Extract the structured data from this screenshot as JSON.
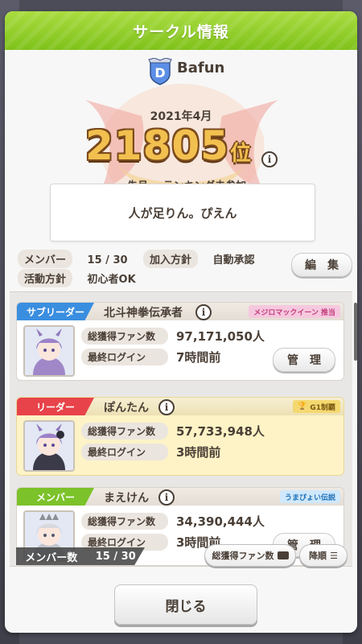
{
  "dialog": {
    "title": "サークル情報"
  },
  "club": {
    "name": "Bafun",
    "month": "2021年4月",
    "rank_number": "21805",
    "rank_suffix": "位",
    "prev_label": "先月",
    "prev_value": "ランキング未参加",
    "comment": "人が足りん。ぴえん",
    "members_label": "メンバー",
    "members_value": "15 / 30",
    "join_label": "加入方針",
    "join_value": "自動承認",
    "policy_label": "活動方針",
    "policy_value": "初心者OK",
    "edit_button": "編　集"
  },
  "members": [
    {
      "role": "サブリーダー",
      "role_color": "#3a8ee0",
      "name": "北斗神拳伝承者",
      "badge": "メジロマックイーン 推当",
      "badge_bg": "#f6c8de",
      "badge_color": "#c23d7e",
      "fans_label": "総獲得ファン数",
      "fans": "97,171,050人",
      "login_label": "最終ログイン",
      "login": "7時間前",
      "manage_button": "管　理"
    },
    {
      "role": "リーダー",
      "role_color": "#e8434a",
      "name": "ぽんたん",
      "badge": "G1制覇",
      "badge_bg": "#f4d870",
      "badge_color": "#7a5a10",
      "fans_label": "総獲得ファン数",
      "fans": "57,733,948人",
      "login_label": "最終ログイン",
      "login": "3時間前"
    },
    {
      "role": "メンバー",
      "role_color": "#7cc22a",
      "name": "まえけん",
      "badge": "うまぴょい伝説",
      "badge_bg": "#cfe8fb",
      "badge_color": "#1d6fb8",
      "fans_label": "総獲得ファン数",
      "fans": "34,390,444人",
      "login_label": "最終ログイン",
      "login": "3時間前",
      "manage_button": "管　理"
    }
  ],
  "footer": {
    "member_count_label": "メンバー数",
    "member_count_value": "15 / 30",
    "sort_field": "総獲得ファン数",
    "sort_order": "降順",
    "close_button": "閉じる"
  }
}
